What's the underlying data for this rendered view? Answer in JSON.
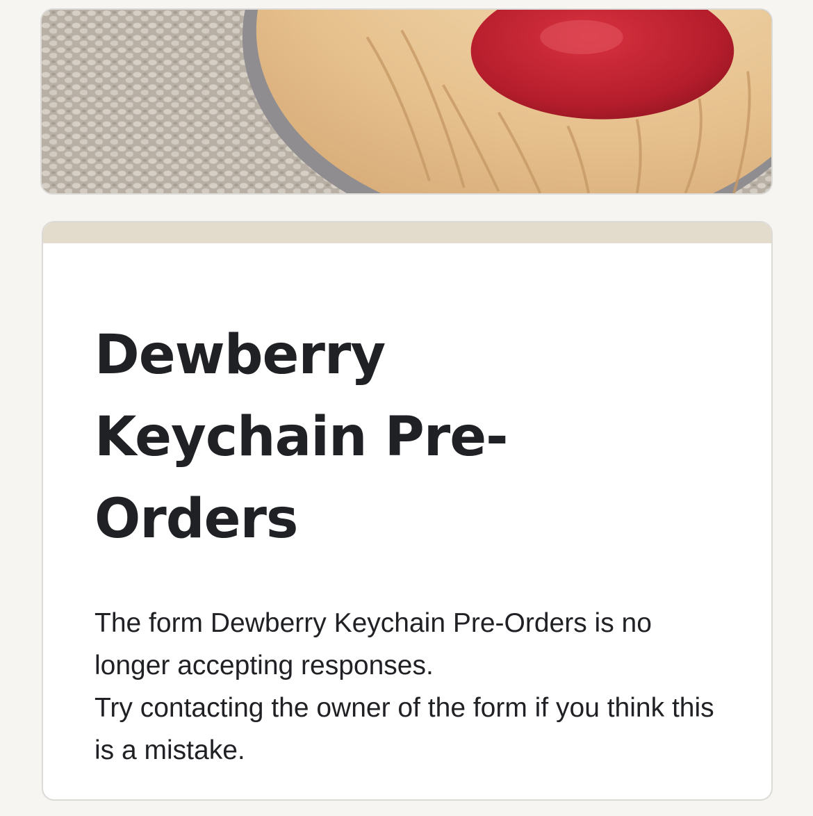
{
  "header": {
    "image_subject": "cookie-with-jam-photo"
  },
  "form": {
    "title": "Dewberry Keychain Pre-Orders",
    "message_line1": "The form Dewberry Keychain Pre-Orders is no longer accepting responses.",
    "message_line2": "Try contacting the owner of the form if you think this is a mistake."
  },
  "colors": {
    "page_background": "#f7f5f1",
    "card_accent": "#e3dccd",
    "text": "#202124"
  }
}
